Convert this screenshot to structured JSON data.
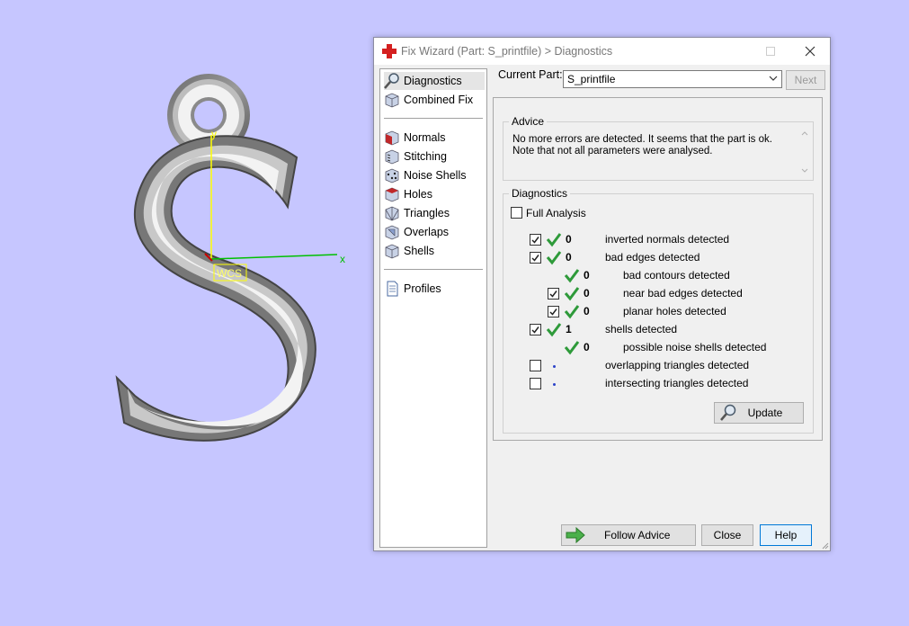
{
  "viewport": {
    "axis_y_label": "y",
    "axis_x_label": "x",
    "wcs_label": "WCS"
  },
  "window": {
    "title": "Fix Wizard (Part: S_printfile) > Diagnostics"
  },
  "nav": {
    "items": [
      {
        "label": "Diagnostics",
        "icon": "magnifier-icon",
        "selected": true
      },
      {
        "label": "Combined Fix",
        "icon": "cube-icon"
      },
      {
        "label": "Normals",
        "icon": "normals-cube-icon"
      },
      {
        "label": "Stitching",
        "icon": "stitching-cube-icon"
      },
      {
        "label": "Noise Shells",
        "icon": "noise-shells-cube-icon"
      },
      {
        "label": "Holes",
        "icon": "holes-cube-icon"
      },
      {
        "label": "Triangles",
        "icon": "triangles-cube-icon"
      },
      {
        "label": "Overlaps",
        "icon": "overlaps-cube-icon"
      },
      {
        "label": "Shells",
        "icon": "shells-cube-icon"
      },
      {
        "label": "Profiles",
        "icon": "document-icon"
      }
    ]
  },
  "part": {
    "label": "Current Part:",
    "value": "S_printfile",
    "next_label": "Next"
  },
  "advice": {
    "title": "Advice",
    "line1": "No more errors are detected. It seems that the part is ok.",
    "line2": "Note that not all parameters were analysed."
  },
  "diagnostics": {
    "title": "Diagnostics",
    "full_analysis_label": "Full Analysis",
    "rows": [
      {
        "checked": true,
        "ok": true,
        "count": "0",
        "label": "inverted normals detected"
      },
      {
        "checked": true,
        "ok": true,
        "count": "0",
        "label": "bad edges detected"
      },
      {
        "checked": null,
        "ok": true,
        "count": "0",
        "label": "bad contours detected"
      },
      {
        "checked": true,
        "ok": true,
        "count": "0",
        "label": "near bad edges detected"
      },
      {
        "checked": true,
        "ok": true,
        "count": "0",
        "label": "planar holes detected"
      },
      {
        "checked": true,
        "ok": true,
        "count": "1",
        "label": "shells detected"
      },
      {
        "checked": null,
        "ok": true,
        "count": "0",
        "label": "possible noise shells detected"
      },
      {
        "checked": false,
        "ok": false,
        "count": "",
        "label": "overlapping triangles detected"
      },
      {
        "checked": false,
        "ok": false,
        "count": "",
        "label": "intersecting triangles detected"
      }
    ],
    "update_label": "Update"
  },
  "buttons": {
    "follow_advice": "Follow Advice",
    "close": "Close",
    "help": "Help"
  },
  "colors": {
    "background": "#c6c6ff",
    "check_green": "#2e9a3a",
    "axis_y": "#ffff00",
    "axis_x": "#00c000"
  }
}
